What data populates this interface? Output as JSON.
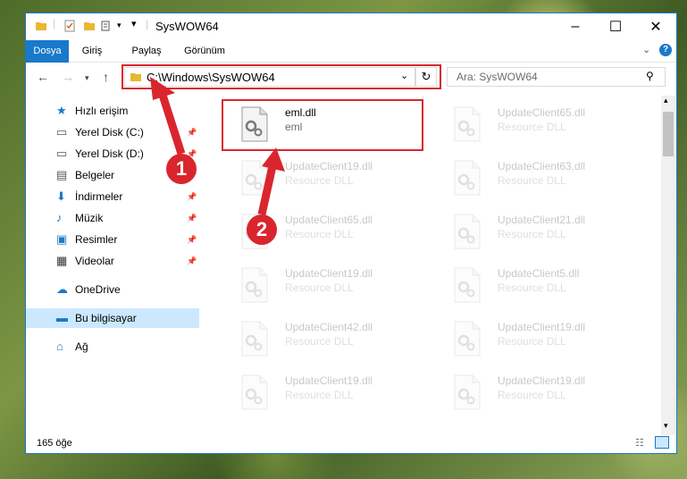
{
  "window": {
    "title": "SysWOW64",
    "controls": {
      "minimize": "–",
      "maximize": "☐",
      "close": "✕"
    }
  },
  "ribbon": {
    "tabs": [
      "Dosya",
      "Giriş",
      "Paylaş",
      "Görünüm"
    ],
    "help": "?"
  },
  "nav": {
    "address": "C:\\Windows\\SysWOW64",
    "search_placeholder": "Ara: SysWOW64"
  },
  "sidebar": {
    "items": [
      {
        "label": "Hızlı erişim",
        "icon": "star-icon"
      },
      {
        "label": "Yerel Disk (C:)",
        "icon": "drive-icon",
        "pinned": true
      },
      {
        "label": "Yerel Disk (D:)",
        "icon": "drive-icon",
        "pinned": true
      },
      {
        "label": "Belgeler",
        "icon": "documents-icon",
        "pinned": true
      },
      {
        "label": "İndirmeler",
        "icon": "downloads-icon",
        "pinned": true
      },
      {
        "label": "Müzik",
        "icon": "music-icon",
        "pinned": true
      },
      {
        "label": "Resimler",
        "icon": "pictures-icon",
        "pinned": true
      },
      {
        "label": "Videolar",
        "icon": "videos-icon",
        "pinned": true
      },
      {
        "label": "OneDrive",
        "icon": "cloud-icon"
      },
      {
        "label": "Bu bilgisayar",
        "icon": "computer-icon",
        "selected": true
      },
      {
        "label": "Ağ",
        "icon": "network-icon"
      }
    ]
  },
  "files": [
    {
      "name": "eml.dll",
      "type": "eml"
    },
    {
      "name": "UpdateClient65.dll",
      "type": "Resource DLL"
    },
    {
      "name": "UpdateClient19.dll",
      "type": "Resource DLL"
    },
    {
      "name": "UpdateClient63.dll",
      "type": "Resource DLL"
    },
    {
      "name": "UpdateClient65.dll",
      "type": "Resource DLL"
    },
    {
      "name": "UpdateClient21.dll",
      "type": "Resource DLL"
    },
    {
      "name": "UpdateClient19.dll",
      "type": "Resource DLL"
    },
    {
      "name": "UpdateClient5.dll",
      "type": "Resource DLL"
    },
    {
      "name": "UpdateClient42.dll",
      "type": "Resource DLL"
    },
    {
      "name": "UpdateClient19.dll",
      "type": "Resource DLL"
    },
    {
      "name": "UpdateClient19.dll",
      "type": "Resource DLL"
    },
    {
      "name": "UpdateClient19.dll",
      "type": "Resource DLL"
    }
  ],
  "status": {
    "count": "165 öğe"
  },
  "annotations": {
    "step1": "1",
    "step2": "2",
    "color": "#d9262e"
  }
}
